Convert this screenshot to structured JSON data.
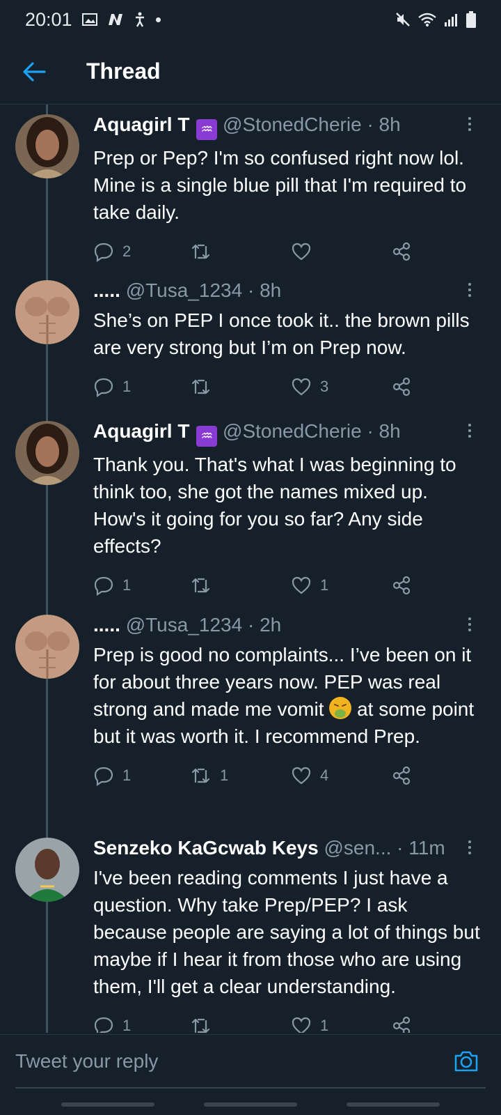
{
  "status_bar": {
    "time": "20:01",
    "left_icons": [
      "gallery-icon",
      "n-icon",
      "accessibility-icon",
      "dot-icon"
    ],
    "right_icons": [
      "mute-icon",
      "wifi-icon",
      "signal-icon",
      "battery-icon"
    ]
  },
  "header": {
    "title": "Thread"
  },
  "tweets": [
    {
      "name": "Aquagirl T",
      "badge": "♒",
      "handle": "@StonedCherie",
      "time": "· 8h",
      "text": "Prep or Pep? I'm so confused right now lol. Mine is a single blue pill that I'm required to take daily.",
      "replies": "2",
      "retweets": "",
      "likes": ""
    },
    {
      "name": ".....",
      "handle": "@Tusa_1234",
      "time": "· 8h",
      "text": "She’s on PEP I once took it.. the brown pills are very strong but I’m on Prep now.",
      "replies": "1",
      "retweets": "",
      "likes": "3"
    },
    {
      "name": "Aquagirl T",
      "badge": "♒",
      "handle": "@StonedCherie",
      "time": "· 8h",
      "text": "Thank you. That's what I was beginning to think too, she got the names mixed up. How's it going for you so far? Any side effects?",
      "replies": "1",
      "retweets": "",
      "likes": "1"
    },
    {
      "name": ".....",
      "handle": "@Tusa_1234",
      "time": "· 2h",
      "text_before": "Prep is good no complaints... I’ve been on it for about three years now. PEP was real strong and made me vomit",
      "text_after": "at some point but it was worth it. I recommend Prep.",
      "replies": "1",
      "retweets": "1",
      "likes": "4"
    },
    {
      "name": "Senzeko KaGcwab Keys",
      "handle": "@sen...",
      "time": "· 11m",
      "text": "I've been reading comments I just have a question. Why take Prep/PEP? I ask because people are saying a lot of things but maybe if I hear it from those who are using them, I'll get a clear understanding.",
      "replies": "1",
      "retweets": "",
      "likes": "1"
    }
  ],
  "reply_bar": {
    "placeholder": "Tweet your reply"
  },
  "colors": {
    "background": "#15202b",
    "accent": "#1da1f2",
    "muted": "#8899a6"
  }
}
